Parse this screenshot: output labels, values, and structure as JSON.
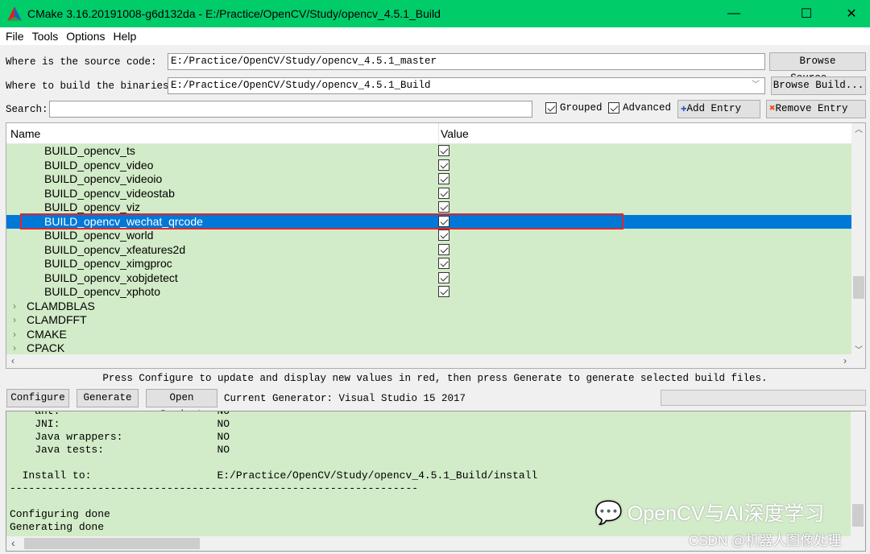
{
  "window": {
    "title": "CMake 3.16.20191008-g6d132da - E:/Practice/OpenCV/Study/opencv_4.5.1_Build",
    "minimize": "—",
    "maximize": "☐",
    "close": "✕"
  },
  "menu": [
    "File",
    "Tools",
    "Options",
    "Help"
  ],
  "source": {
    "label": "Where is the source code:",
    "value": "E:/Practice/OpenCV/Study/opencv_4.5.1_master",
    "button": "Browse Source..."
  },
  "build": {
    "label": "Where to build the binaries:",
    "value": "E:/Practice/OpenCV/Study/opencv_4.5.1_Build",
    "button": "Browse Build..."
  },
  "search": {
    "label": "Search:",
    "value": ""
  },
  "options": {
    "grouped": {
      "label": "Grouped",
      "checked": true
    },
    "advanced": {
      "label": "Advanced",
      "checked": true
    },
    "add_entry": "Add Entry",
    "remove_entry": "Remove Entry"
  },
  "table": {
    "columns": [
      "Name",
      "Value"
    ],
    "rows": [
      {
        "name": "BUILD_opencv_ts",
        "checked": true
      },
      {
        "name": "BUILD_opencv_video",
        "checked": true
      },
      {
        "name": "BUILD_opencv_videoio",
        "checked": true
      },
      {
        "name": "BUILD_opencv_videostab",
        "checked": true
      },
      {
        "name": "BUILD_opencv_viz",
        "checked": true
      },
      {
        "name": "BUILD_opencv_wechat_qrcode",
        "checked": true,
        "selected": true
      },
      {
        "name": "BUILD_opencv_world",
        "checked": true
      },
      {
        "name": "BUILD_opencv_xfeatures2d",
        "checked": true
      },
      {
        "name": "BUILD_opencv_ximgproc",
        "checked": true
      },
      {
        "name": "BUILD_opencv_xobjdetect",
        "checked": true
      },
      {
        "name": "BUILD_opencv_xphoto",
        "checked": true
      },
      {
        "name": "CLAMDBLAS",
        "group": true
      },
      {
        "name": "CLAMDFFT",
        "group": true
      },
      {
        "name": "CMAKE",
        "group": true
      },
      {
        "name": "CPACK",
        "group": true
      }
    ]
  },
  "status_text": "Press Configure to update and display new values in red, then press Generate to generate selected build files.",
  "actions": {
    "configure": "Configure",
    "generate": "Generate",
    "open_project": "Open Project",
    "generator": "Current Generator: Visual Studio 15 2017"
  },
  "output": [
    "    ant:                         NO",
    "    JNI:                         NO",
    "    Java wrappers:               NO",
    "    Java tests:                  NO",
    "",
    "  Install to:                    E:/Practice/OpenCV/Study/opencv_4.5.1_Build/install",
    "-----------------------------------------------------------------",
    "",
    "Configuring done",
    "Generating done"
  ],
  "watermark": {
    "main": "OpenCV与AI深度学习",
    "sub": "CSDN @机器人图像处理"
  },
  "colors": {
    "titlebar": "#00cc6a",
    "row_bg": "#d2ebc8",
    "selection": "#0078d7",
    "highlight_box": "#e0252b"
  }
}
